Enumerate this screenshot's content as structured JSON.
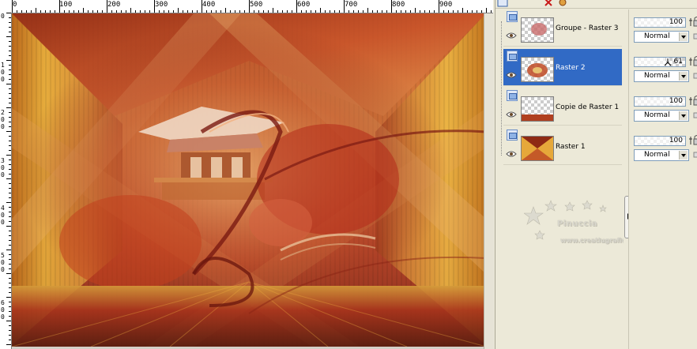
{
  "ruler": {
    "top_labels": [
      "0",
      "100",
      "200",
      "300",
      "400",
      "500",
      "600",
      "700",
      "800",
      "900"
    ],
    "left_labels": [
      "0",
      "1 0 0",
      "2 0 0",
      "3 0 0",
      "4 0 0",
      "5 0 0",
      "6 0 0"
    ]
  },
  "layers": [
    {
      "name": "Groupe - Raster 3",
      "selected": false
    },
    {
      "name": "Raster 2",
      "selected": true
    },
    {
      "name": "Copie de Raster 1",
      "selected": false
    },
    {
      "name": "Raster 1",
      "selected": false
    }
  ],
  "props": [
    {
      "opacity": "100",
      "opacity_fraction": 1.0,
      "blend": "Normal"
    },
    {
      "opacity": "61",
      "opacity_fraction": 0.61,
      "blend": "Normal"
    },
    {
      "opacity": "100",
      "opacity_fraction": 1.0,
      "blend": "Normal"
    },
    {
      "opacity": "100",
      "opacity_fraction": 1.0,
      "blend": "Normal"
    }
  ],
  "watermark": {
    "title": "Pinuccia",
    "url": "www.creatiugrafica.eu"
  },
  "colors": {
    "selection": "#316ac5",
    "panel": "#ece9d8"
  }
}
